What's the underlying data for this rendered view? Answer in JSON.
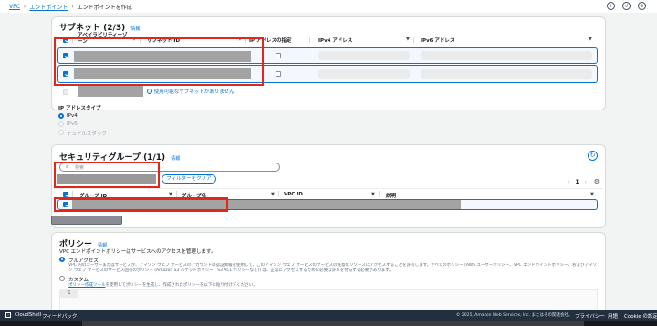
{
  "breadcrumb": {
    "vpc": "VPC",
    "endpoints": "エンドポイント",
    "current": "エンドポイントを作成"
  },
  "subnets": {
    "title": "サブネット",
    "count": "(2/3)",
    "info": "情報",
    "col_az": "アベイラビリティーゾーン",
    "col_subnet_id": "サブネット ID",
    "col_ip_spec": "IP アドレスの指定",
    "col_ipv4": "IPv4 アドレス",
    "col_ipv6": "IPv6 アドレス",
    "no_subnet_msg": "使用可能なサブネットがありません"
  },
  "ip_type": {
    "label": "IP アドレスタイプ",
    "options": [
      "IPv4",
      "IPv6",
      "デュアルスタック"
    ]
  },
  "security_groups": {
    "title": "セキュリティグループ",
    "count": "(1/1)",
    "info": "情報",
    "search_placeholder": "検索",
    "clear_filter": "フィルターをクリア",
    "page": "1",
    "col_group_id": "グループ ID",
    "col_group_name": "グループ名",
    "col_vpc_id": "VPC ID",
    "col_description": "説明"
  },
  "policy": {
    "title": "ポリシー",
    "info": "情報",
    "subtitle": "VPC エンドポイントポリシーはサービスへのアクセスを管理します。",
    "full_access": "フルアクセス",
    "full_access_desc": "VPC 内のユーザーまたはサービスが、アマゾン ウェブ サービスのアカウントの認証情報を使用して、このアマゾン ウェブ サービスのサービスの任意のリソースにアクセスすることを許可します。すべてのポリシー (AWS ユーザーポリシー、VPC エンドポイントポリシー、およびアマゾン ウェブ サービスのサービス固有のポリシー (Amazon S3 バケットポリシー、S3 ACL ポリシーなど)) は、正常にアクセスするために必要な許可を付与する必要があります。",
    "custom": "カスタム",
    "custom_desc_link": "ポリシー作成ツール",
    "custom_desc": "を使用してポリシーを生成し、作成されたポリシーを以下に貼り付けてください。",
    "editor_line": "1"
  },
  "footer": {
    "cloudshell": "CloudShell",
    "feedback": "フィードバック",
    "copyright": "© 2025, Amazon Web Services, Inc. またはその関連会社。",
    "privacy": "プライバシー",
    "terms": "用語",
    "cookie": "Cookie の設定"
  }
}
